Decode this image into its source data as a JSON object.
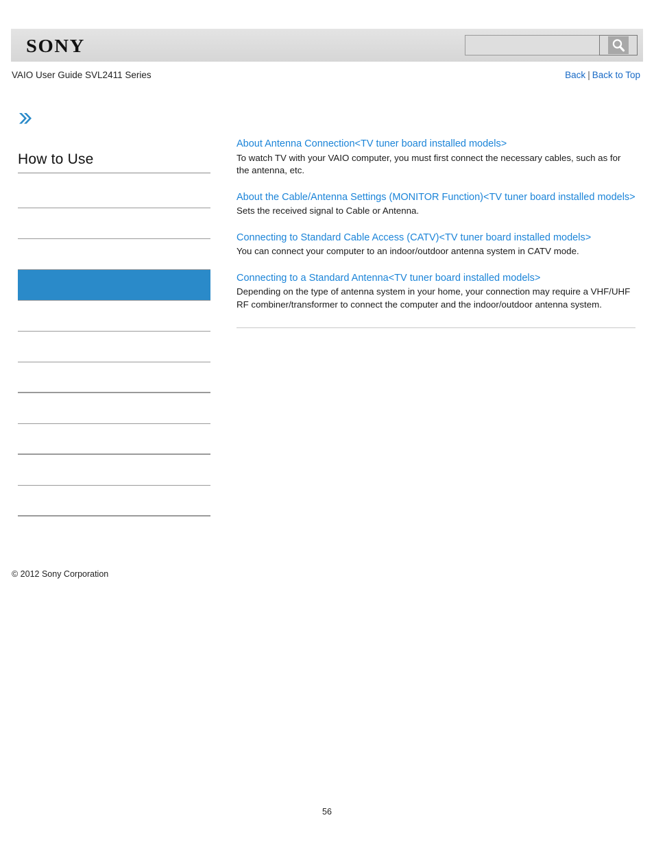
{
  "header": {
    "logo_text": "SONY",
    "logo_icon": "sony-wordmark",
    "search": {
      "value": "",
      "placeholder": "",
      "button_icon": "search-icon"
    }
  },
  "subheader": {
    "guide_title": "VAIO User Guide SVL2411 Series",
    "back_label": "Back",
    "separator": "|",
    "back_to_top_label": "Back to Top"
  },
  "sidebar": {
    "breadcrumb_icon": "double-chevron-right-icon",
    "heading": "How to Use",
    "items": [
      {
        "label": "",
        "selected": false,
        "thick": false
      },
      {
        "label": "",
        "selected": false,
        "thick": false
      },
      {
        "label": "",
        "selected": false,
        "thick": false
      },
      {
        "label": "",
        "selected": true,
        "thick": false
      },
      {
        "label": "",
        "selected": false,
        "thick": false
      },
      {
        "label": "",
        "selected": false,
        "thick": false
      },
      {
        "label": "",
        "selected": false,
        "thick": true
      },
      {
        "label": "",
        "selected": false,
        "thick": false
      },
      {
        "label": "",
        "selected": false,
        "thick": true
      },
      {
        "label": "",
        "selected": false,
        "thick": false
      },
      {
        "label": "",
        "selected": false,
        "thick": true
      }
    ]
  },
  "main": {
    "entries": [
      {
        "title": "About Antenna Connection<TV tuner board installed models>",
        "description": "To watch TV with your VAIO computer, you must first connect the necessary cables, such as for the antenna, etc."
      },
      {
        "title": "About the Cable/Antenna Settings (MONITOR Function)<TV tuner board installed models>",
        "description": "Sets the received signal to Cable or Antenna."
      },
      {
        "title": "Connecting to Standard Cable Access (CATV)<TV tuner board installed models>",
        "description": "You can connect your computer to an indoor/outdoor antenna system in CATV mode."
      },
      {
        "title": "Connecting to a Standard Antenna<TV tuner board installed models>",
        "description": "Depending on the type of antenna system in your home, your connection may require a VHF/UHF RF combiner/transformer to connect the computer and the indoor/outdoor antenna system."
      }
    ]
  },
  "footer": {
    "copyright": "© 2012 Sony Corporation",
    "page_number": "56"
  },
  "colors": {
    "link_blue": "#1b84d8",
    "header_link_blue": "#1769c5",
    "selected_item_blue": "#2a8ac9",
    "header_band_gray": "#dcdcdc",
    "divider_gray": "#9a9a9a"
  }
}
